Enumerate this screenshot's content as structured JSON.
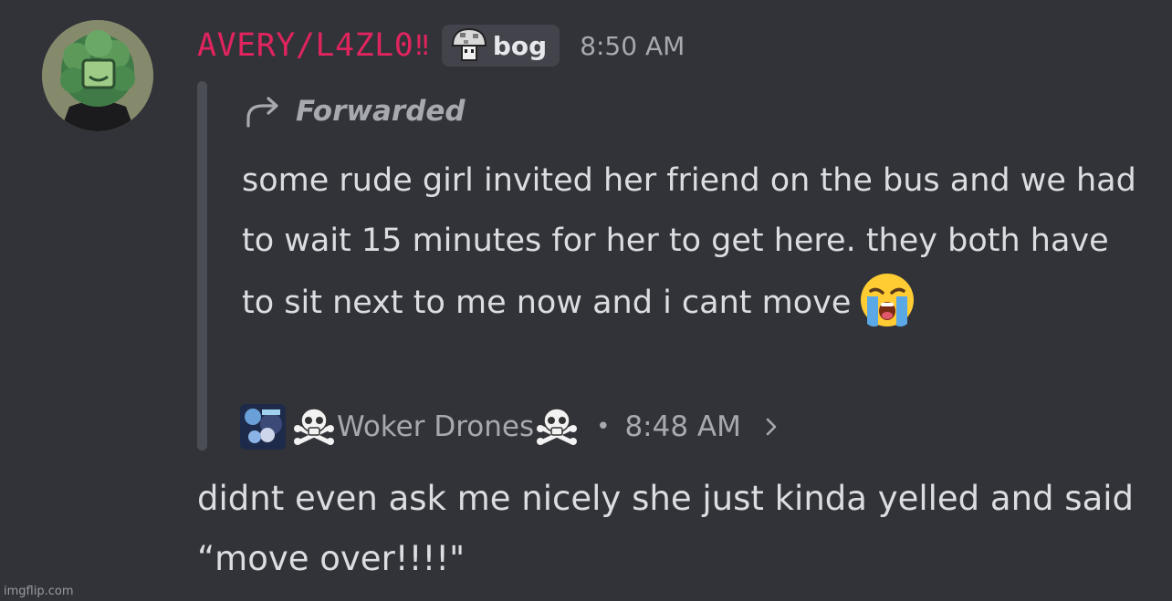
{
  "message": {
    "author": "AVERY/L4ZL0",
    "author_suffix": "‼",
    "author_color": "#e0245e",
    "tag": {
      "icon": "mushroom-icon",
      "label": "bog"
    },
    "timestamp": "8:50 AM",
    "forwarded": {
      "label": "Forwarded",
      "text": "some rude girl invited her friend on the bus and we had to wait 15 minutes for her to get here. they both have to sit next to me now and i cant move",
      "emoji": "loudly-crying-face-icon",
      "source": {
        "channel_prefix_icon": "skull-crossbones-icon",
        "channel": "Woker Drones",
        "channel_suffix_icon": "skull-crossbones-icon",
        "separator": "•",
        "timestamp": "8:48 AM"
      }
    },
    "text": "didnt even ask me nicely she just kinda yelled and said “move over!!!!\""
  },
  "watermark": "imgflip.com",
  "colors": {
    "background": "#323339",
    "muted": "#a7a9b0",
    "text": "#dbdee1"
  }
}
